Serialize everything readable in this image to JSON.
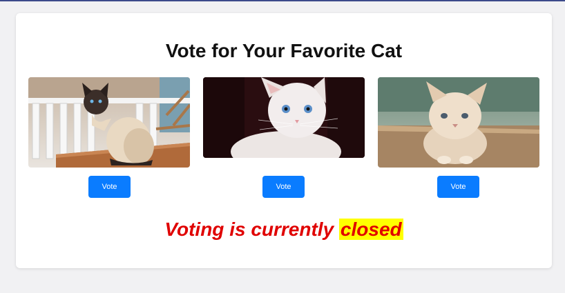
{
  "page": {
    "title": "Vote for Your Favorite Cat",
    "status_prefix": "Voting is currently ",
    "status_highlight": "closed"
  },
  "cats": [
    {
      "image": "siamese-cat-on-table",
      "vote_label": "Vote"
    },
    {
      "image": "white-kitten-closeup",
      "vote_label": "Vote"
    },
    {
      "image": "fluffy-cream-kitten",
      "vote_label": "Vote"
    }
  ],
  "colors": {
    "accent": "#0a7cff",
    "status_text": "#e00000",
    "highlight": "#ffff00"
  }
}
